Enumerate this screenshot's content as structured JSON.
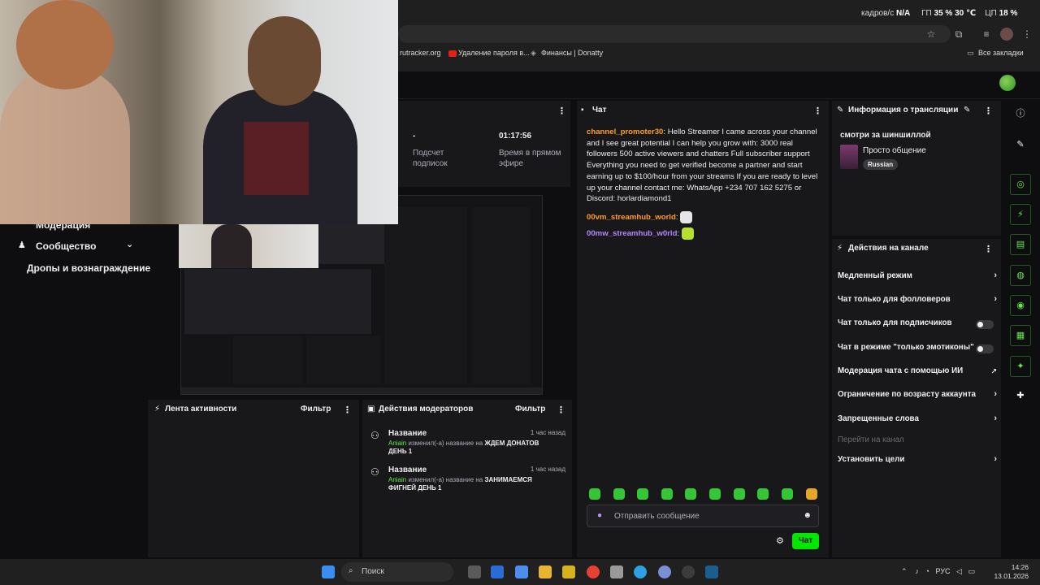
{
  "perf": {
    "fps_label": "кадров/с",
    "fps_value": "N/A",
    "gpu_label": "ГП",
    "gpu_value": "35 %",
    "gpu_temp": "30 ℃",
    "cpu_label": "ЦП",
    "cpu_value": "18 %"
  },
  "bookmarks": {
    "items": [
      "rutracker.org",
      "Удаление пароля в...",
      "Финансы | Donatty"
    ],
    "all_label": "Все закладки"
  },
  "left_nav": {
    "moderation": "Модерация",
    "community": "Сообщество",
    "drops": "Дропы и вознаграждение"
  },
  "stats": {
    "subs_value": "-",
    "subs_label": "Подсчет подписок",
    "airtime_value": "01:17:56",
    "airtime_label": "Время в прямом эфире"
  },
  "activity": {
    "title": "Лента активности",
    "filter": "Фильтр"
  },
  "mod_actions": {
    "title": "Действия модераторов",
    "filter": "Фильтр",
    "entries": [
      {
        "title": "Название",
        "time": "1 час назад",
        "user": "Aniain",
        "action": " изменил(-а) название на ",
        "value": "ЖДЕМ ДОНАТОВ ДЕНЬ 1"
      },
      {
        "title": "Название",
        "time": "1 час назад",
        "user": "Aniain",
        "action": " изменил(-а) название на ",
        "value": "ЗАНИМАЕМСЯ ФИГНЕЙ ДЕНЬ 1"
      }
    ]
  },
  "chat": {
    "title": "Чат",
    "messages": [
      {
        "user": "channel_promoter30",
        "text": ": Hello Streamer I came across your channel and I see great potential I can help you grow with: 3000 real followers 500 active viewers and chatters Full subscriber support Everything you need to get verified become a partner and start earning up to $100/hour from your streams If you are ready to level up your channel contact me: WhatsApp +234 707 162 5275 or Discord: horlardiamond1"
      },
      {
        "user": "00vm_streamhub_world",
        "text": ":"
      },
      {
        "user": "00mw_streamhub_w0rld",
        "text": ":"
      }
    ],
    "input_placeholder": "Отправить сообщение",
    "send_label": "Чат"
  },
  "stream_info": {
    "title": "Информация о трансляции",
    "stream_title": "смотри за шиншиллой",
    "category": "Просто общение",
    "tag": "Russian"
  },
  "channel_actions": {
    "title": "Действия на канале",
    "items": [
      {
        "label": "Медленный режим",
        "control": "chevron"
      },
      {
        "label": "Чат только для фолловеров",
        "control": "chevron"
      },
      {
        "label": "Чат только для подписчиков",
        "control": "toggle"
      },
      {
        "label": "Чат в режиме \"только эмотиконы\"",
        "control": "toggle"
      },
      {
        "label": "Модерация чата с помощью ИИ",
        "control": "external"
      },
      {
        "label": "Ограничение по возрасту аккаунта",
        "control": "chevron"
      },
      {
        "label": "Запрещенные слова",
        "control": "chevron"
      },
      {
        "label": "Перейти на канал",
        "control": "none"
      },
      {
        "label": "Установить цели",
        "control": "chevron"
      }
    ]
  },
  "taskbar": {
    "search": "Поиск",
    "lang": "РУС",
    "time": "14:26",
    "date": "13.01.2026"
  },
  "colors": {
    "accent": "#00e800",
    "username_orange": "#ff9e22",
    "username_purple": "#b388ff",
    "panel": "#18181b",
    "background": "#0e0e10"
  }
}
